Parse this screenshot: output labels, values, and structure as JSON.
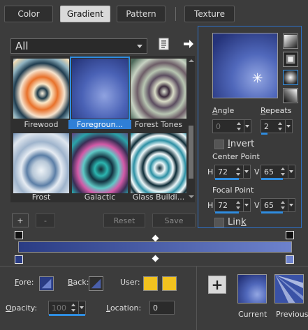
{
  "tabs": [
    {
      "label": "Color",
      "active": false
    },
    {
      "label": "Gradient",
      "active": true
    },
    {
      "label": "Pattern",
      "active": false
    },
    {
      "label": "Texture",
      "active": false
    }
  ],
  "category": {
    "selected": "All"
  },
  "thumbnails": [
    {
      "label": "Firewood",
      "selected": false
    },
    {
      "label": "Foregroun...",
      "selected": true
    },
    {
      "label": "Forest Tones",
      "selected": false
    },
    {
      "label": "Frost",
      "selected": false
    },
    {
      "label": "Galactic",
      "selected": false
    },
    {
      "label": "Glass Buildi...",
      "selected": false
    }
  ],
  "list_buttons": {
    "add": "+",
    "remove": "-",
    "reset": "Reset",
    "save": "Save"
  },
  "panel": {
    "angle_label": "Angle",
    "angle_value": "0",
    "repeats_label": "Repeats",
    "repeats_value": "2",
    "invert_label": "Invert",
    "center_point_label": "Center Point",
    "center_h_label": "H",
    "center_h_value": "72",
    "center_v_label": "V",
    "center_v_value": "65",
    "focal_point_label": "Focal Point",
    "focal_h_label": "H",
    "focal_h_value": "72",
    "focal_v_label": "V",
    "focal_v_value": "65",
    "link_label": "Link"
  },
  "bottom": {
    "fore_label": "Fore:",
    "back_label": "Back:",
    "user_label": "User:",
    "opacity_label": "Opacity:",
    "opacity_value": "100",
    "location_label": "Location:",
    "location_value": "0",
    "add_button": "+",
    "current_label": "Current",
    "previous_label": "Previous"
  },
  "colors": {
    "accent": "#2f8de0",
    "gradient_dark": "#2a3c84",
    "gradient_light": "#7f92d6",
    "user_swatch": "#f2c21f"
  }
}
